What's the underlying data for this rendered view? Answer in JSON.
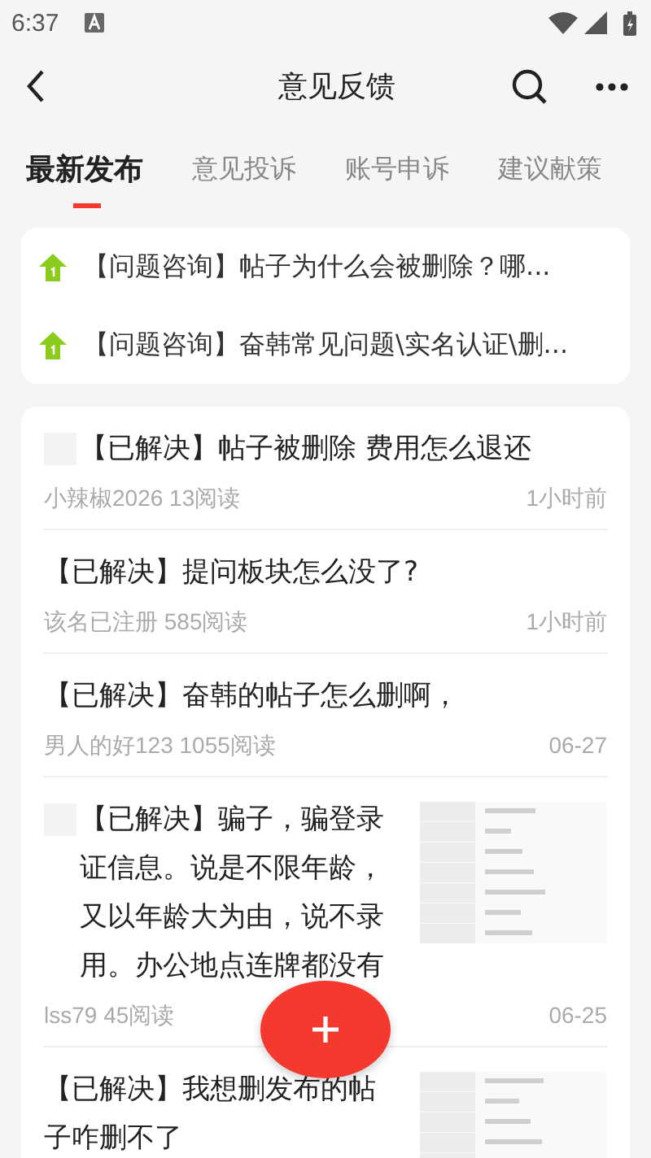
{
  "status_bar": {
    "time": "6:37"
  },
  "header": {
    "title": "意见反馈"
  },
  "tabs": [
    {
      "label": "最新发布",
      "selected": true
    },
    {
      "label": "意见投诉",
      "selected": false
    },
    {
      "label": "账号申诉",
      "selected": false
    },
    {
      "label": "建议献策",
      "selected": false
    }
  ],
  "pinned": [
    {
      "title": "【问题咨询】帖子为什么会被删除？哪..."
    },
    {
      "title": "【问题咨询】奋韩常见问题\\实名认证\\删..."
    }
  ],
  "posts": [
    {
      "title": "【已解决】帖子被删除 费用怎么退还",
      "tag_box": true,
      "has_image": false,
      "meta": "小辣椒2026 13阅读",
      "time": "1小时前"
    },
    {
      "title": "【已解决】提问板块怎么没了?",
      "tag_box": false,
      "has_image": false,
      "meta": "该名已注册 585阅读",
      "time": "1小时前"
    },
    {
      "title": "【已解决】奋韩的帖子怎么删啊，",
      "tag_box": false,
      "has_image": false,
      "meta": "男人的好123 1055阅读",
      "time": "06-27"
    },
    {
      "title": "【已解决】骗子，骗登录证信息。说是不限年龄，又以年龄大为由，说不录用。办公地点连牌都没有",
      "tag_box": true,
      "has_image": true,
      "meta": "lss79 45阅读",
      "time": "06-25"
    },
    {
      "title": "【已解决】我想删发布的帖子咋删不了",
      "tag_box": false,
      "has_image": true
    }
  ]
}
